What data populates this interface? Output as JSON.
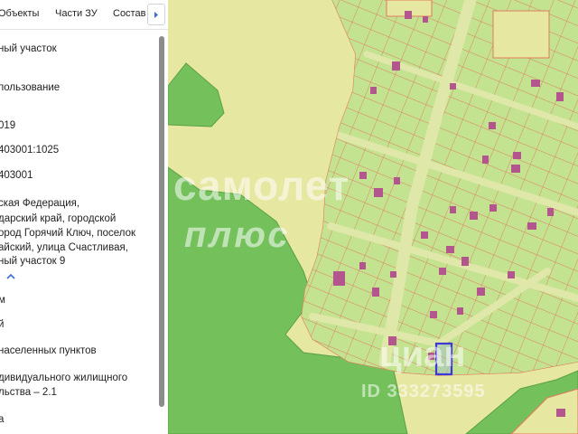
{
  "tabs": {
    "objects": "Объекты",
    "parts": "Части ЗУ",
    "composition": "Состав"
  },
  "info": {
    "land_type": "ный участок",
    "usage": "пользование",
    "year": "019",
    "cadastral_number": "403001:1025",
    "quarter": "403001",
    "address_line1": "ская Федерация,",
    "address_line2": "дарский край, городской",
    "address_line3": "ород Горячий Ключ, поселок",
    "address_line4": "айский, улица Счастливая,",
    "address_line5": "ный участок 9",
    "area": "м",
    "status": "й",
    "category": "населенных пунктов",
    "permitted_use_line1": "дивидуального жилищного",
    "permitted_use_line2": "льства – 2.1",
    "last_row": "а"
  },
  "watermark": {
    "brand_top": "самолет",
    "brand_bottom": "плюс",
    "cian": "циан",
    "listing_id": "ID 333273595"
  },
  "colors": {
    "map_background": "#e6e7a0",
    "parcel_fill": "#c3e391",
    "parcel_border": "#e07a5f",
    "forest": "#74c15c",
    "building": "#b3568e",
    "selected_parcel": "#3b3ad6"
  }
}
